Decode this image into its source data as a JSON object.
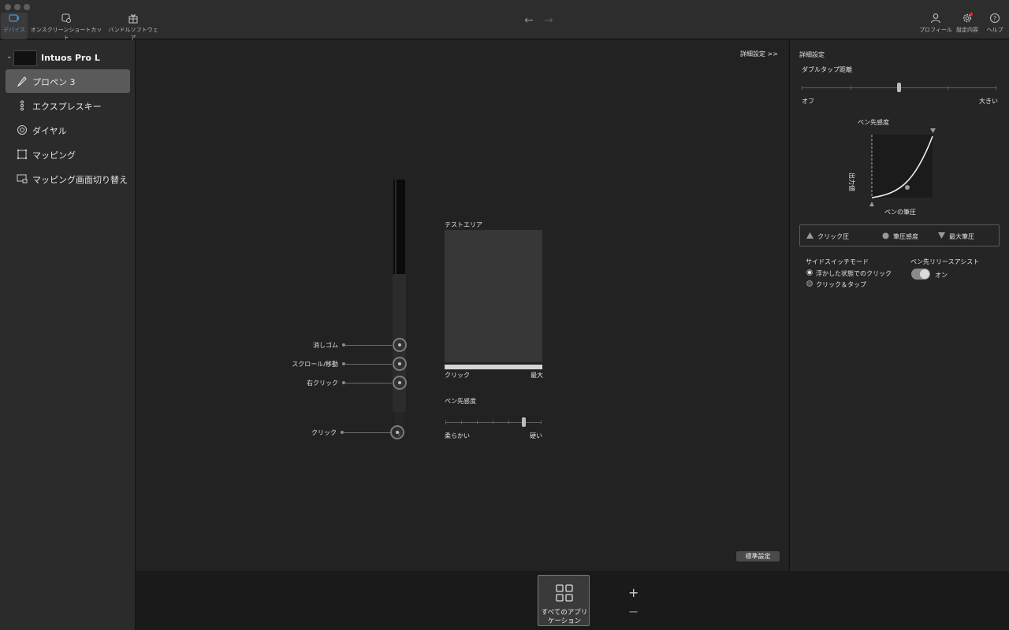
{
  "toolbar": {
    "device_label": "デバイス",
    "shortcut_label": "オンスクリーンショートカット",
    "bundle_label": "バンドルソフトウェア",
    "profile_label": "プロフィール",
    "settings_label": "設定内容",
    "help_label": "ヘルプ",
    "accent": "#4b8fe6",
    "notification_color": "#e02a3a"
  },
  "sidebar": {
    "device_name": "Intuos Pro L",
    "items": [
      {
        "label": "プロペン 3",
        "icon": "pen-icon"
      },
      {
        "label": "エクスプレスキー",
        "icon": "expresskey-icon"
      },
      {
        "label": "ダイヤル",
        "icon": "dial-icon"
      },
      {
        "label": "マッピング",
        "icon": "mapping-icon"
      },
      {
        "label": "マッピング画面切り替え",
        "icon": "screen-toggle-icon"
      }
    ]
  },
  "main": {
    "advanced_link": "詳細設定 >>",
    "pen_buttons": {
      "eraser": "消しゴム",
      "scroll": "スクロール/移動",
      "right_click": "右クリック",
      "click": "クリック"
    },
    "test_area_title": "テストエリア",
    "test_bar_left": "クリック",
    "test_bar_right": "最大",
    "tip_feel_title": "ペン先感度",
    "tip_feel_left": "柔らかい",
    "tip_feel_right": "硬い",
    "tip_feel_level": 0.82,
    "default_button": "標準設定"
  },
  "right_panel": {
    "title": "詳細設定",
    "double_tap_title": "ダブルタップ距離",
    "double_tap_left": "オフ",
    "double_tap_right": "大きい",
    "double_tap_level": 0.5,
    "curve_title": "ペン先感度",
    "curve_y_label": "出力値",
    "curve_x_label": "ペンの筆圧",
    "legend_click": "クリック圧",
    "legend_sensitivity": "筆圧感度",
    "legend_max": "最大筆圧",
    "side_switch_title": "サイドスイッチモード",
    "side_switch_opt1": "浮かした状態でのクリック",
    "side_switch_opt2": "クリック＆タップ",
    "release_assist_title": "ペン先リリースアシスト",
    "release_assist_state": "オン"
  },
  "bottom": {
    "all_apps_line1": "すべてのアプリ",
    "all_apps_line2": "ケーション",
    "add_label": "+",
    "remove_label": "−"
  }
}
